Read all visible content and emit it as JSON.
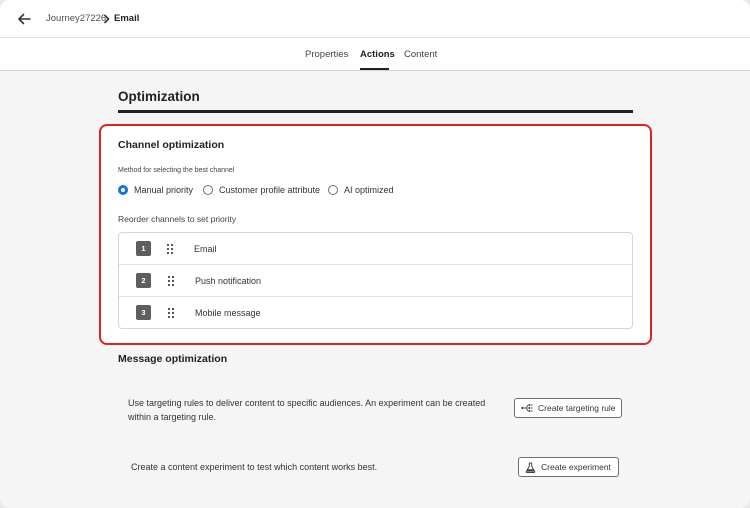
{
  "breadcrumb": {
    "parent": "Journey27226",
    "current": "Email"
  },
  "tabs": [
    {
      "label": "Properties",
      "active": false
    },
    {
      "label": "Actions",
      "active": true
    },
    {
      "label": "Content",
      "active": false
    }
  ],
  "optimization": {
    "title": "Optimization"
  },
  "channel_optimization": {
    "title": "Channel optimization",
    "method_label": "Method for selecting the best channel",
    "methods": [
      {
        "label": "Manual priority",
        "selected": true
      },
      {
        "label": "Customer profile attribute",
        "selected": false
      },
      {
        "label": "AI optimized",
        "selected": false
      }
    ],
    "reorder_label": "Reorder channels to set priority",
    "channels": [
      {
        "rank": "1",
        "name": "Email"
      },
      {
        "rank": "2",
        "name": "Push notification"
      },
      {
        "rank": "3",
        "name": "Mobile message"
      }
    ]
  },
  "message_optimization": {
    "title": "Message optimization",
    "targeting_description": "Use targeting rules to deliver content to specific audiences. An experiment can be created within a targeting rule.",
    "targeting_button": "Create targeting rule",
    "experiment_description": "Create a content experiment to test which content works best.",
    "experiment_button": "Create experiment"
  },
  "colors": {
    "accent": "#1473e6",
    "highlight": "#e0241b",
    "badge": "#5e5e5e"
  },
  "icons": {
    "back": "arrow-left-icon",
    "breadcrumb_separator": "chevron-right-icon",
    "drag": "drag-handle-icon",
    "targeting": "targeting-rule-icon",
    "experiment": "beaker-icon"
  }
}
